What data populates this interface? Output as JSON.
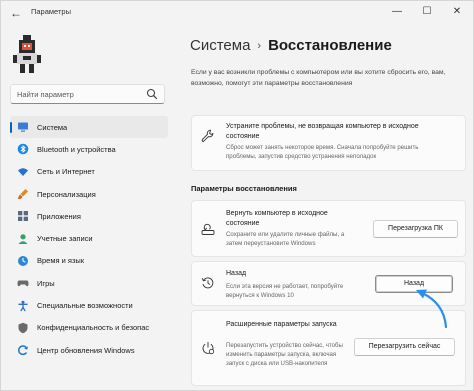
{
  "window": {
    "title": "Параметры",
    "back_icon": "back-arrow-icon",
    "controls": {
      "minimize": "—",
      "maximize": "☐",
      "close": "✕"
    }
  },
  "sidebar": {
    "search_placeholder": "Найти параметр",
    "items": [
      {
        "label": "Система",
        "icon": "monitor-icon",
        "color": "#3a7bd5",
        "active": true
      },
      {
        "label": "Bluetooth и устройства",
        "icon": "bluetooth-icon",
        "color": "#1e88e5"
      },
      {
        "label": "Сеть и Интернет",
        "icon": "network-icon",
        "color": "#2d6fd0"
      },
      {
        "label": "Персонализация",
        "icon": "brush-icon",
        "color": "#e0892b"
      },
      {
        "label": "Приложения",
        "icon": "apps-icon",
        "color": "#5a6b80"
      },
      {
        "label": "Учетные записи",
        "icon": "account-icon",
        "color": "#2ea36d"
      },
      {
        "label": "Время и язык",
        "icon": "globe-clock-icon",
        "color": "#2b88d8"
      },
      {
        "label": "Игры",
        "icon": "gamepad-icon",
        "color": "#6a6a6a"
      },
      {
        "label": "Специальные возможности",
        "icon": "accessibility-icon",
        "color": "#2d6fd0"
      },
      {
        "label": "Конфиденциальность и безопас",
        "icon": "shield-icon",
        "color": "#6a6a6a"
      },
      {
        "label": "Центр обновления Windows",
        "icon": "update-icon",
        "color": "#1e78c8"
      }
    ]
  },
  "main": {
    "breadcrumb": {
      "parent": "Система",
      "separator": "›",
      "current": "Восстановление"
    },
    "intro": "Если у вас возникли проблемы с компьютером или вы хотите сбросить его, вам, возможно, помогут эти параметры восстановления",
    "troubleshoot": {
      "title": "Устраните проблемы, не возвращая компьютер в исходное состояние",
      "subtitle": "Сброс может занять некоторое время. Сначала попробуйте решить проблемы, запустив средство устранения неполадок",
      "icon": "wrench-icon"
    },
    "section_title": "Параметры восстановления",
    "options": [
      {
        "title": "Вернуть компьютер в исходное состояние",
        "subtitle": "Сохраните или удалите личные файлы, а затем переустановите Windows",
        "button": "Перезагрузка ПК",
        "icon": "reset-pc-icon"
      },
      {
        "title": "Назад",
        "subtitle": "Если эта версия не работает, попробуйте вернуться к Windows 10",
        "button": "Назад",
        "icon": "history-icon"
      },
      {
        "title": "Расширенные параметры запуска",
        "subtitle": "Перезапустить устройство сейчас, чтобы изменить параметры запуска, включая запуск с диска или USB-накопителя",
        "button": "Перезагрузить сейчас",
        "icon": "advanced-startup-icon"
      }
    ],
    "annotation_color": "#2a8fe8"
  }
}
